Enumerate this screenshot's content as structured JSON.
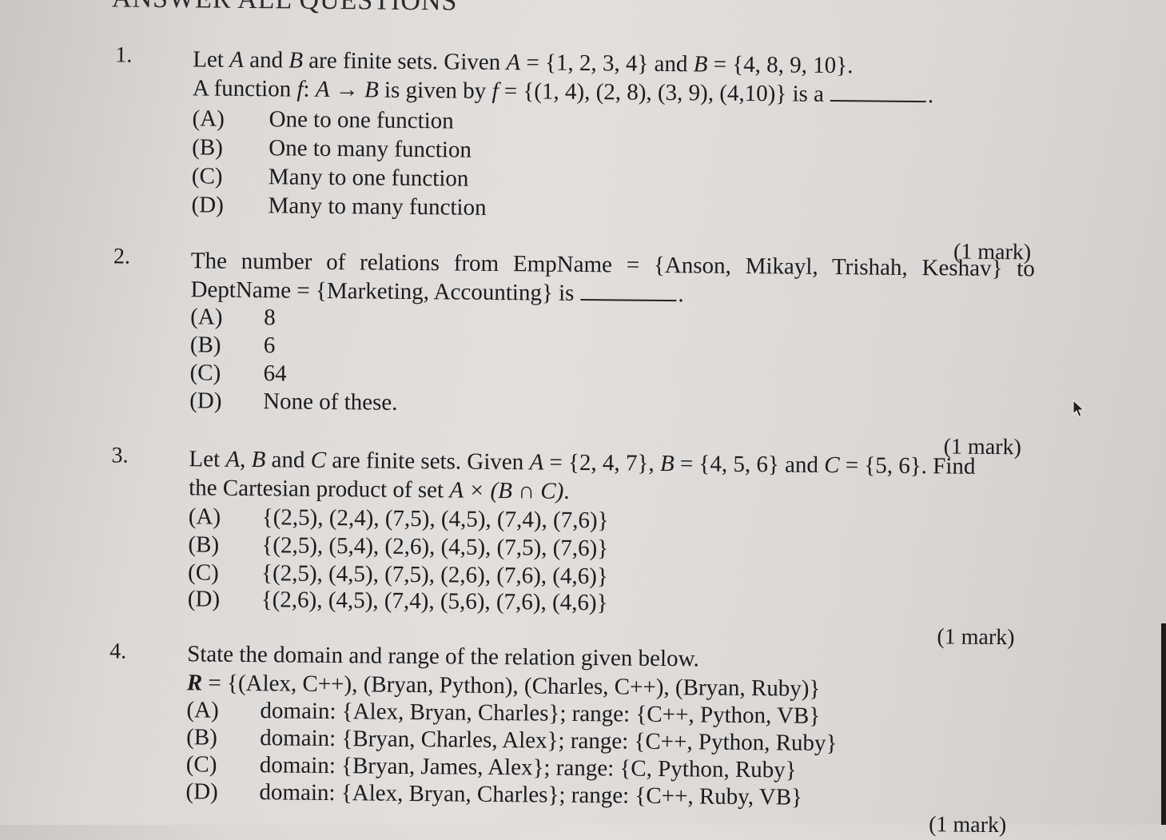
{
  "section_title": "ANSWER ALL QUESTIONS",
  "questions": [
    {
      "number": "1.",
      "lines": [
        {
          "pre": "Let ",
          "v1": "A",
          "mid1": " and ",
          "v2": "B",
          "mid2": " are finite sets. Given ",
          "v3": "A",
          "post": " = {1, 2, 3, 4} and  ",
          "v4": "B",
          "post2": " = {4, 8, 9, 10}."
        },
        {
          "pre": "A function ",
          "v1": "f",
          "mid1": ": ",
          "v2": "A",
          "mid2": " → ",
          "v3": "B",
          "mid3": " is given by ",
          "v4": "f",
          "post": " = {(1, 4), (2, 8), (3, 9), (4,10)} is a",
          "end": "."
        }
      ],
      "options": [
        {
          "label": "(A)",
          "text": "One to one function"
        },
        {
          "label": "(B)",
          "text": "One to many function"
        },
        {
          "label": "(C)",
          "text": "Many to one function"
        },
        {
          "label": "(D)",
          "text": "Many to many function"
        }
      ],
      "mark": "(1 mark)"
    },
    {
      "number": "2.",
      "lines": [
        {
          "text": "The number of relations from EmpName = {Anson, Mikayl, Trishah, Keshav} to"
        },
        {
          "text": "DeptName = {Marketing, Accounting} is",
          "end": "."
        }
      ],
      "options": [
        {
          "label": "(A)",
          "text": "8"
        },
        {
          "label": "(B)",
          "text": "6"
        },
        {
          "label": "(C)",
          "text": "64"
        },
        {
          "label": "(D)",
          "text": "None of these."
        }
      ],
      "mark": "(1 mark)"
    },
    {
      "number": "3.",
      "lines": [
        {
          "pre": "Let ",
          "v1": "A",
          "mid1": ", ",
          "v2": "B",
          "mid2": " and ",
          "v3": "C",
          "mid3": " are finite sets. Given ",
          "v4": "A",
          "mid4": " = {2, 4, 7}, ",
          "v5": "B",
          "mid5": " = {4, 5, 6} and ",
          "v6": "C",
          "post": " = {5, 6}.  Find"
        },
        {
          "pre": "the Cartesian product of set  ",
          "expr": "A × (B ∩ C)",
          "post": "."
        }
      ],
      "options": [
        {
          "label": "(A)",
          "text": "{(2,5), (2,4), (7,5), (4,5), (7,4), (7,6)}"
        },
        {
          "label": "(B)",
          "text": "{(2,5), (5,4), (2,6), (4,5), (7,5), (7,6)}"
        },
        {
          "label": "(C)",
          "text": "{(2,5), (4,5), (7,5), (2,6), (7,6), (4,6)}"
        },
        {
          "label": "(D)",
          "text": "{(2,6), (4,5), (7,4), (5,6), (7,6), (4,6)}"
        }
      ],
      "mark": "(1 mark)"
    },
    {
      "number": "4.",
      "lines": [
        {
          "text": "State the domain and range of the relation given below."
        },
        {
          "v1": "R",
          "post": " = {(Alex, C++), (Bryan, Python), (Charles, C++), (Bryan, Ruby)}"
        }
      ],
      "options": [
        {
          "label": "(A)",
          "text": "domain: {Alex, Bryan, Charles}; range: {C++, Python, VB}"
        },
        {
          "label": "(B)",
          "text": "domain: {Bryan, Charles, Alex}; range: {C++, Python, Ruby}"
        },
        {
          "label": "(C)",
          "text": "domain: {Bryan, James, Alex}; range: {C, Python, Ruby}"
        },
        {
          "label": "(D)",
          "text": "domain: {Alex, Bryan, Charles}; range: {C++, Ruby, VB}"
        }
      ],
      "mark": "(1 mark)"
    }
  ]
}
